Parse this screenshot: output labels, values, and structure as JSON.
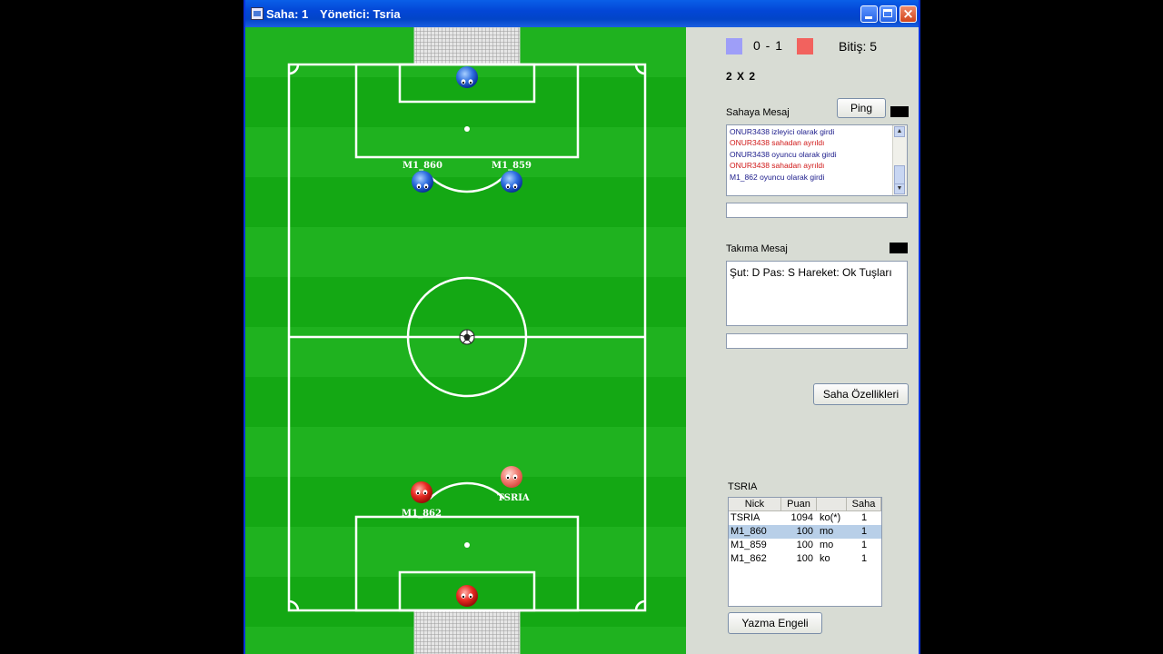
{
  "window": {
    "title_room": "Saha: 1",
    "title_admin": "Yönetici: Tsria"
  },
  "field": {
    "players": [
      {
        "team": "blue",
        "label": ""
      },
      {
        "team": "blue",
        "label": "M1_860"
      },
      {
        "team": "blue",
        "label": "M1_859"
      },
      {
        "team": "red",
        "label": "TSRIA"
      },
      {
        "team": "red",
        "label": "M1_862"
      },
      {
        "team": "red",
        "label": ""
      }
    ]
  },
  "score": {
    "text": "0 - 1",
    "end_label": "Bitiş: 5",
    "blue_color": "#9e9ef8",
    "red_color": "#f2625e"
  },
  "mode": "2 X 2",
  "field_chat": {
    "label": "Sahaya Mesaj",
    "ping_button": "Ping",
    "messages": [
      {
        "text": "ONUR3438 izleyici olarak girdi",
        "color": "#1a1a8a"
      },
      {
        "text": "ONUR3438 sahadan ayrıldı",
        "color": "#d01818"
      },
      {
        "text": "ONUR3438 oyuncu olarak girdi",
        "color": "#1a1a8a"
      },
      {
        "text": "ONUR3438 sahadan ayrıldı",
        "color": "#d01818"
      },
      {
        "text": "M1_862 oyuncu olarak girdi",
        "color": "#1a1a8a"
      }
    ],
    "input_value": ""
  },
  "team_chat": {
    "label": "Takıma Mesaj",
    "text": "Şut: D    Pas: S    Hareket: Ok Tuşları",
    "input_value": ""
  },
  "field_settings_button": "Saha Özellikleri",
  "players_table": {
    "title": "TSRIA",
    "columns": [
      "Nick",
      "Puan",
      "",
      "Saha"
    ],
    "rows": [
      {
        "nick": "TSRIA",
        "puan": "1094",
        "status": "ko(*)",
        "saha": "1",
        "selected": false
      },
      {
        "nick": "M1_860",
        "puan": "100",
        "status": "mo",
        "saha": "1",
        "selected": true
      },
      {
        "nick": "M1_859",
        "puan": "100",
        "status": "mo",
        "saha": "1",
        "selected": false
      },
      {
        "nick": "M1_862",
        "puan": "100",
        "status": "ko",
        "saha": "1",
        "selected": false
      }
    ]
  },
  "mute_button": "Yazma Engeli"
}
